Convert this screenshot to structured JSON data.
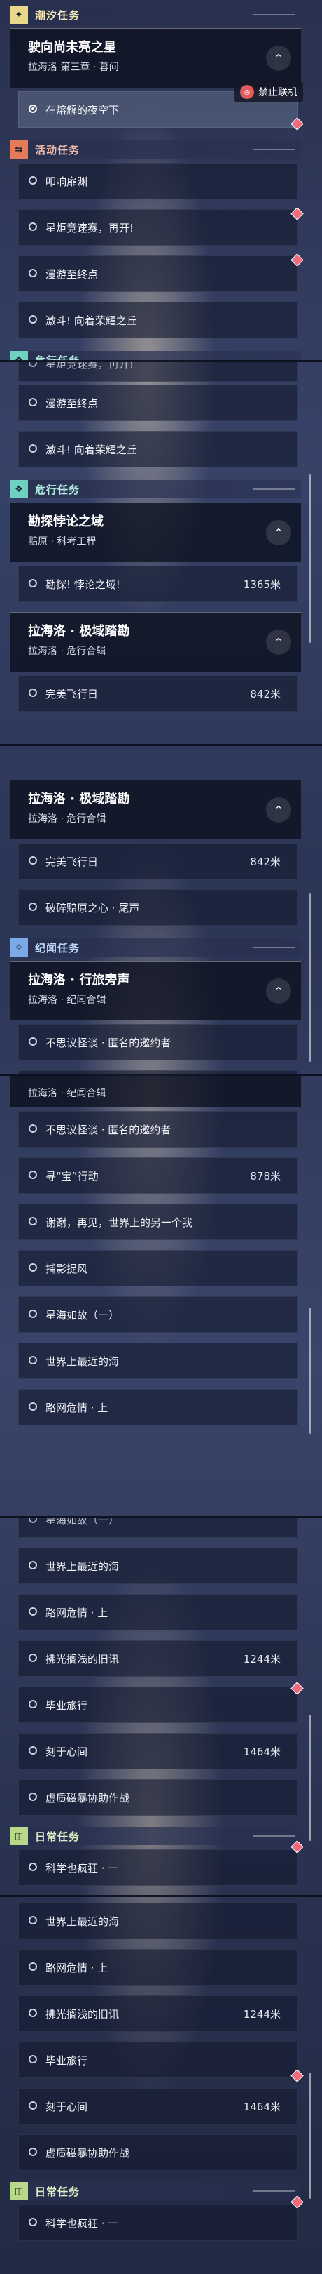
{
  "categories": {
    "tide": {
      "label": "潮汐任务",
      "badge": "✦"
    },
    "activity": {
      "label": "活动任务",
      "badge": "⇆"
    },
    "danger": {
      "label": "危行任务",
      "badge": "❖"
    },
    "chronicle": {
      "label": "纪闻任务",
      "badge": "✧"
    },
    "daily": {
      "label": "日常任务",
      "badge": "◫"
    }
  },
  "tide_quest": {
    "title": "驶向尚未亮之星",
    "subtitle": "拉海洛 第三章 · 暮间",
    "step": "在熔解的夜空下"
  },
  "multiplayer_badge": "禁止联机",
  "activity_quests": [
    "叩响扉渊",
    "星炬竞速赛，再开!",
    "漫游至终点",
    "激斗! 向着荣耀之丘"
  ],
  "danger_quest_1": {
    "title": "勘探悖论之域",
    "subtitle": "黯原 · 科考工程",
    "step": "勘探! 悖论之域!",
    "distance": "1365米"
  },
  "danger_quest_2": {
    "title": "拉海洛 · 极域踏勘",
    "subtitle": "拉海洛 · 危行合辑",
    "step": "完美飞行日",
    "distance": "842米",
    "step2": "破碎黯原之心 · 尾声"
  },
  "chronicle_quest": {
    "title": "拉海洛 · 行旅旁声",
    "subtitle": "拉海洛 · 纪闻合辑",
    "steps": [
      "不思议怪谈 · 匿名的邀约者",
      "寻“宝”行动",
      "谢谢，再见，世界上的另一个我",
      "捕影捉风",
      "星海如故（一）",
      "世界上最近的海",
      "路网危情 · 上",
      "拂光搁浅的旧讯",
      "毕业旅行",
      "刻于心间",
      "虚质磁暴协助作战"
    ],
    "distances": {
      "treasure": "878米",
      "old_news": "1244米",
      "heart": "1464米"
    }
  },
  "daily_quest": {
    "step": "科学也疯狂 · 一"
  }
}
